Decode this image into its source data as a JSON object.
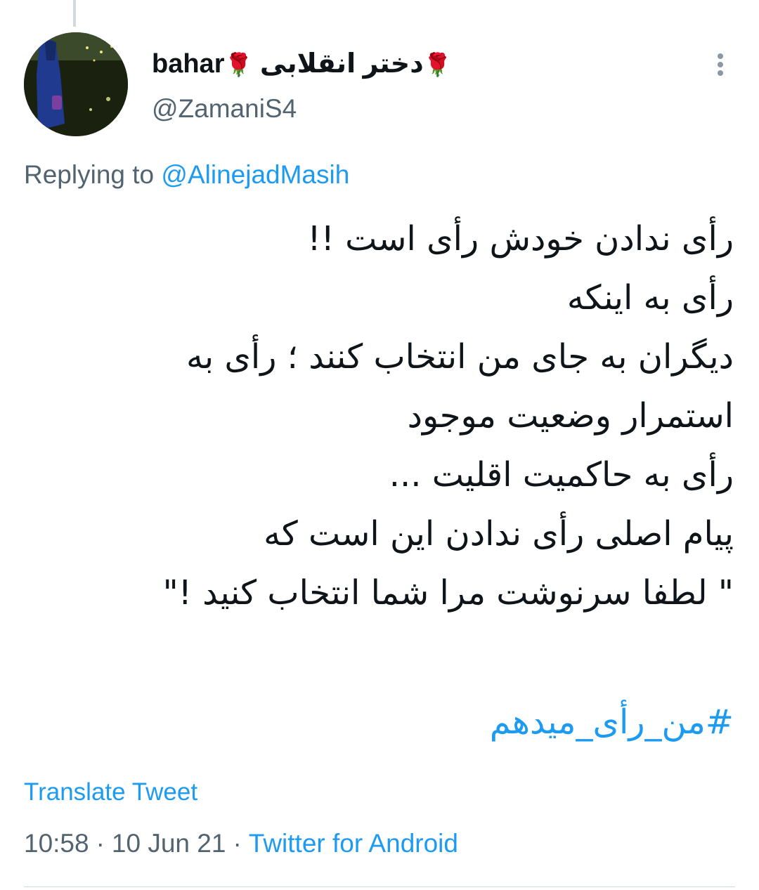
{
  "colors": {
    "link": "#1d9bf0",
    "muted": "#536471",
    "text": "#0f1419",
    "divider": "#cfd9de"
  },
  "author": {
    "display_name_prefix": "bahar",
    "display_name_text": "دختر انقلابی",
    "rose_emoji": "🌹",
    "handle": "@ZamaniS4",
    "avatar_icon": "profile-photo"
  },
  "reply": {
    "prefix": "Replying to",
    "to": "@AlinejadMasih"
  },
  "tweet": {
    "lines": [
      "رأی ندادن خودش رأی است !!",
      "رأی به اینکه",
      "دیگران به جای من انتخاب کنند ؛ رأی به",
      "استمرار وضعیت موجود",
      "رأی به حاکمیت اقلیت ...",
      "پیام اصلی رأی ندادن این است که",
      "\" لطفا سرنوشت مرا شما انتخاب کنید !\""
    ],
    "hashtag": "#من_رأی_میدهم"
  },
  "actions": {
    "translate_label": "Translate Tweet",
    "more_icon": "more-vertical-icon"
  },
  "meta": {
    "time": "10:58",
    "separator": "·",
    "date": "10 Jun 21",
    "source": "Twitter for Android"
  }
}
